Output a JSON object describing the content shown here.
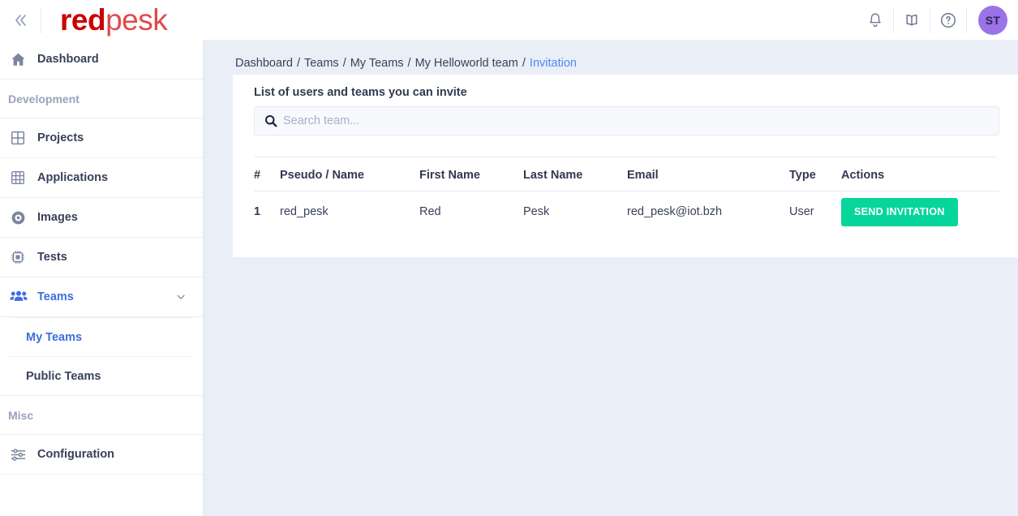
{
  "header": {
    "collapse_icon": "double-chevron-left-icon",
    "brand_part1": "red",
    "brand_part2": "pesk",
    "notifications_icon": "bell-icon",
    "docs_icon": "book-icon",
    "help_icon": "question-circle-icon",
    "avatar_initials": "ST",
    "avatar_color": "#9b72e8"
  },
  "sidebar": {
    "items": [
      {
        "label": "Dashboard",
        "icon": "home-icon",
        "active": false
      },
      {
        "label": "Development",
        "type": "section"
      },
      {
        "label": "Projects",
        "icon": "grid-2x2-icon",
        "active": false
      },
      {
        "label": "Applications",
        "icon": "grid-3x3-icon",
        "active": false
      },
      {
        "label": "Images",
        "icon": "disc-icon",
        "active": false
      },
      {
        "label": "Tests",
        "icon": "chip-icon",
        "active": false
      },
      {
        "label": "Teams",
        "icon": "users-icon",
        "active": true,
        "chevron": "chevron-down-icon"
      },
      {
        "label": "My Teams",
        "type": "sub",
        "active": true
      },
      {
        "label": "Public Teams",
        "type": "sub",
        "active": false
      },
      {
        "label": "Misc",
        "type": "section"
      },
      {
        "label": "Configuration",
        "icon": "sliders-icon",
        "active": false
      }
    ],
    "active_color": "#3c6ee0"
  },
  "breadcrumb": {
    "items": [
      "Dashboard",
      "Teams",
      "My Teams",
      "My Helloworld team",
      "Invitation"
    ],
    "separator": "/",
    "current_color": "#4a8bf5"
  },
  "card": {
    "title": "List of users and teams you can invite",
    "search": {
      "icon": "search-icon",
      "placeholder": "Search team...",
      "value": ""
    },
    "table": {
      "columns": [
        "#",
        "Pseudo / Name",
        "First Name",
        "Last Name",
        "Email",
        "Type",
        "Actions"
      ],
      "rows": [
        {
          "num": "1",
          "pseudo": "red_pesk",
          "first_name": "Red",
          "last_name": "Pesk",
          "email": "red_pesk@iot.bzh",
          "type": "User",
          "action_label": "SEND INVITATION"
        }
      ]
    },
    "action_color": "#06d69b"
  }
}
